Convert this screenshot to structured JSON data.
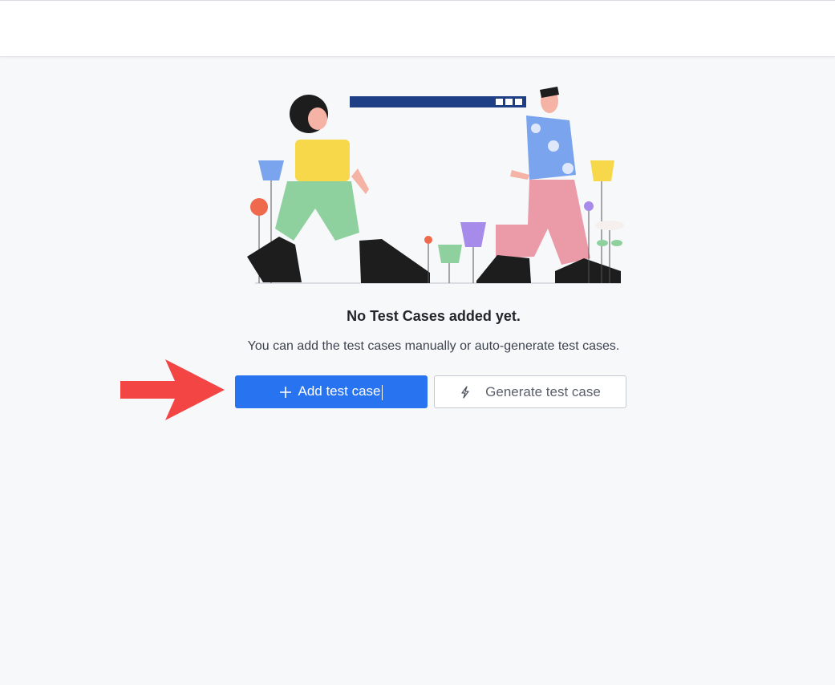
{
  "empty_state": {
    "title": "No Test Cases added yet.",
    "subtitle": "You can add the test cases manually or auto-generate test cases."
  },
  "actions": {
    "add_label": "Add test case",
    "generate_label": "Generate test case"
  },
  "icons": {
    "add": "plus-icon",
    "generate": "lightning-bolt-icon",
    "annotation": "red-arrow-icon"
  },
  "colors": {
    "primary": "#2873f0",
    "annotation_arrow": "#f44545",
    "background": "#f7f8fa"
  }
}
